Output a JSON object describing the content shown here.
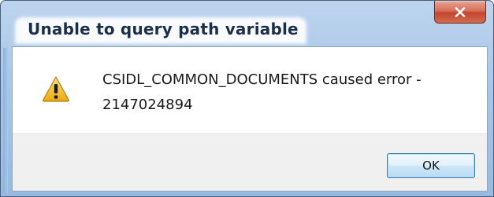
{
  "dialog": {
    "title": "Unable to query path variable",
    "message_line1": "CSIDL_COMMON_DOCUMENTS caused error -",
    "message_line2": "2147024894",
    "ok_label": "OK",
    "icon": "warning-icon",
    "close_icon": "close-icon"
  },
  "colors": {
    "frame": "#a9c6e8",
    "title_text": "#1b2f4b",
    "close_button": "#c24530",
    "footer": "#f0f0f0",
    "ok_border": "#3c7fb1",
    "warning_fill": "#f2c01e"
  }
}
